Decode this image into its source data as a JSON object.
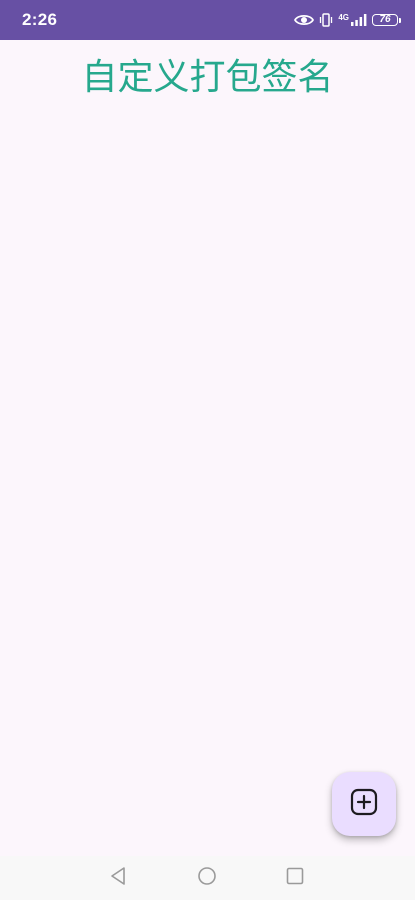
{
  "status_bar": {
    "time": "2:26",
    "network_type": "4G",
    "battery_level": "76",
    "icons": [
      "eye-icon",
      "vibrate-icon",
      "signal-icon",
      "battery-icon"
    ],
    "background_color": "#6750a4"
  },
  "header": {
    "title": "自定义打包签名",
    "title_color": "#26a88d"
  },
  "fab": {
    "icon": "add-box-icon",
    "background_color": "#eaddff"
  },
  "nav_bar": {
    "icons": [
      "back-triangle-icon",
      "home-circle-icon",
      "recents-square-icon"
    ]
  },
  "theme": {
    "background": "#fcf6fc"
  }
}
